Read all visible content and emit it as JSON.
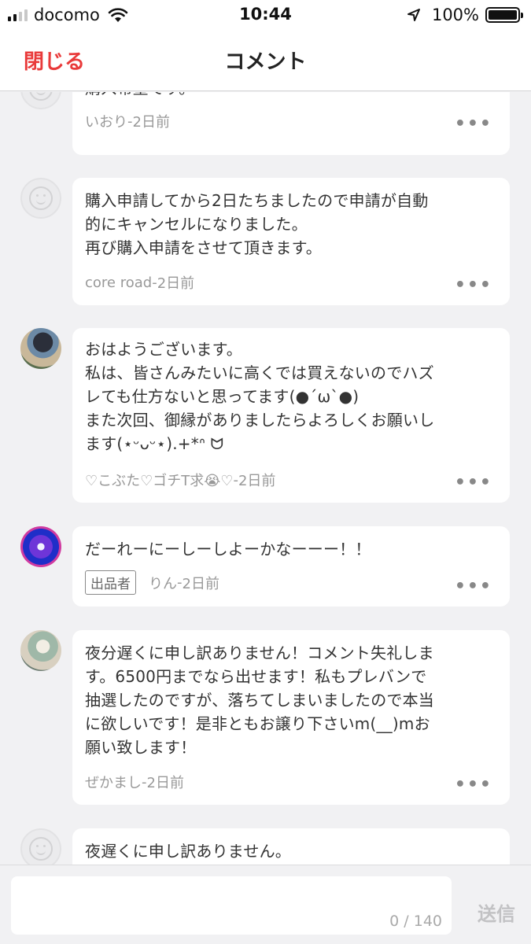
{
  "status_bar": {
    "carrier": "docomo",
    "time": "10:44",
    "battery": "100%",
    "battery_level": 1.0,
    "signal_bars": 2
  },
  "header": {
    "close_label": "閉じる",
    "title": "コメント"
  },
  "comments": [
    {
      "avatar": "default",
      "text": "購入希望です。",
      "user": "いおり",
      "time": "2日前",
      "seller": false
    },
    {
      "avatar": "default",
      "text": "購入申請してから2日たちましたので申請が自動\n的にキャンセルになりました。\n再び購入申請をさせて頂きます。",
      "user": "core road",
      "time": "2日前",
      "seller": false
    },
    {
      "avatar": "photo1",
      "text": "おはようございます。\n私は、皆さんみたいに高くでは買えないのでハズ\nレても仕方ないと思ってます(●´ω`●)\nまた次回、御縁がありましたらよろしくお願いし\nます(⋆ᵕᴗᵕ⋆).+*ᐢ ᗢ",
      "user": "♡こぶた♡ゴチT求😭♡",
      "time": "2日前",
      "seller": false
    },
    {
      "avatar": "photo2",
      "text": "だーれーにーしーしよーかなーーー！！",
      "user": "りん",
      "time": "2日前",
      "seller": true
    },
    {
      "avatar": "photo3",
      "text": "夜分遅くに申し訳ありません！コメント失礼しま\nす。6500円までなら出せます！私もプレバンで\n抽選したのですが、落ちてしまいましたので本当\nに欲しいです！是非ともお譲り下さいm(__)mお\n願い致します！",
      "user": "ぜかまし",
      "time": "2日前",
      "seller": false
    },
    {
      "avatar": "default",
      "text": "夜遅くに申し訳ありません。",
      "user": "",
      "time": "",
      "seller": false
    }
  ],
  "seller_badge": "出品者",
  "meta_separator": " - ",
  "more_label": "•••",
  "input": {
    "placeholder": "",
    "counter": "0 / 140",
    "send_label": "送信"
  }
}
